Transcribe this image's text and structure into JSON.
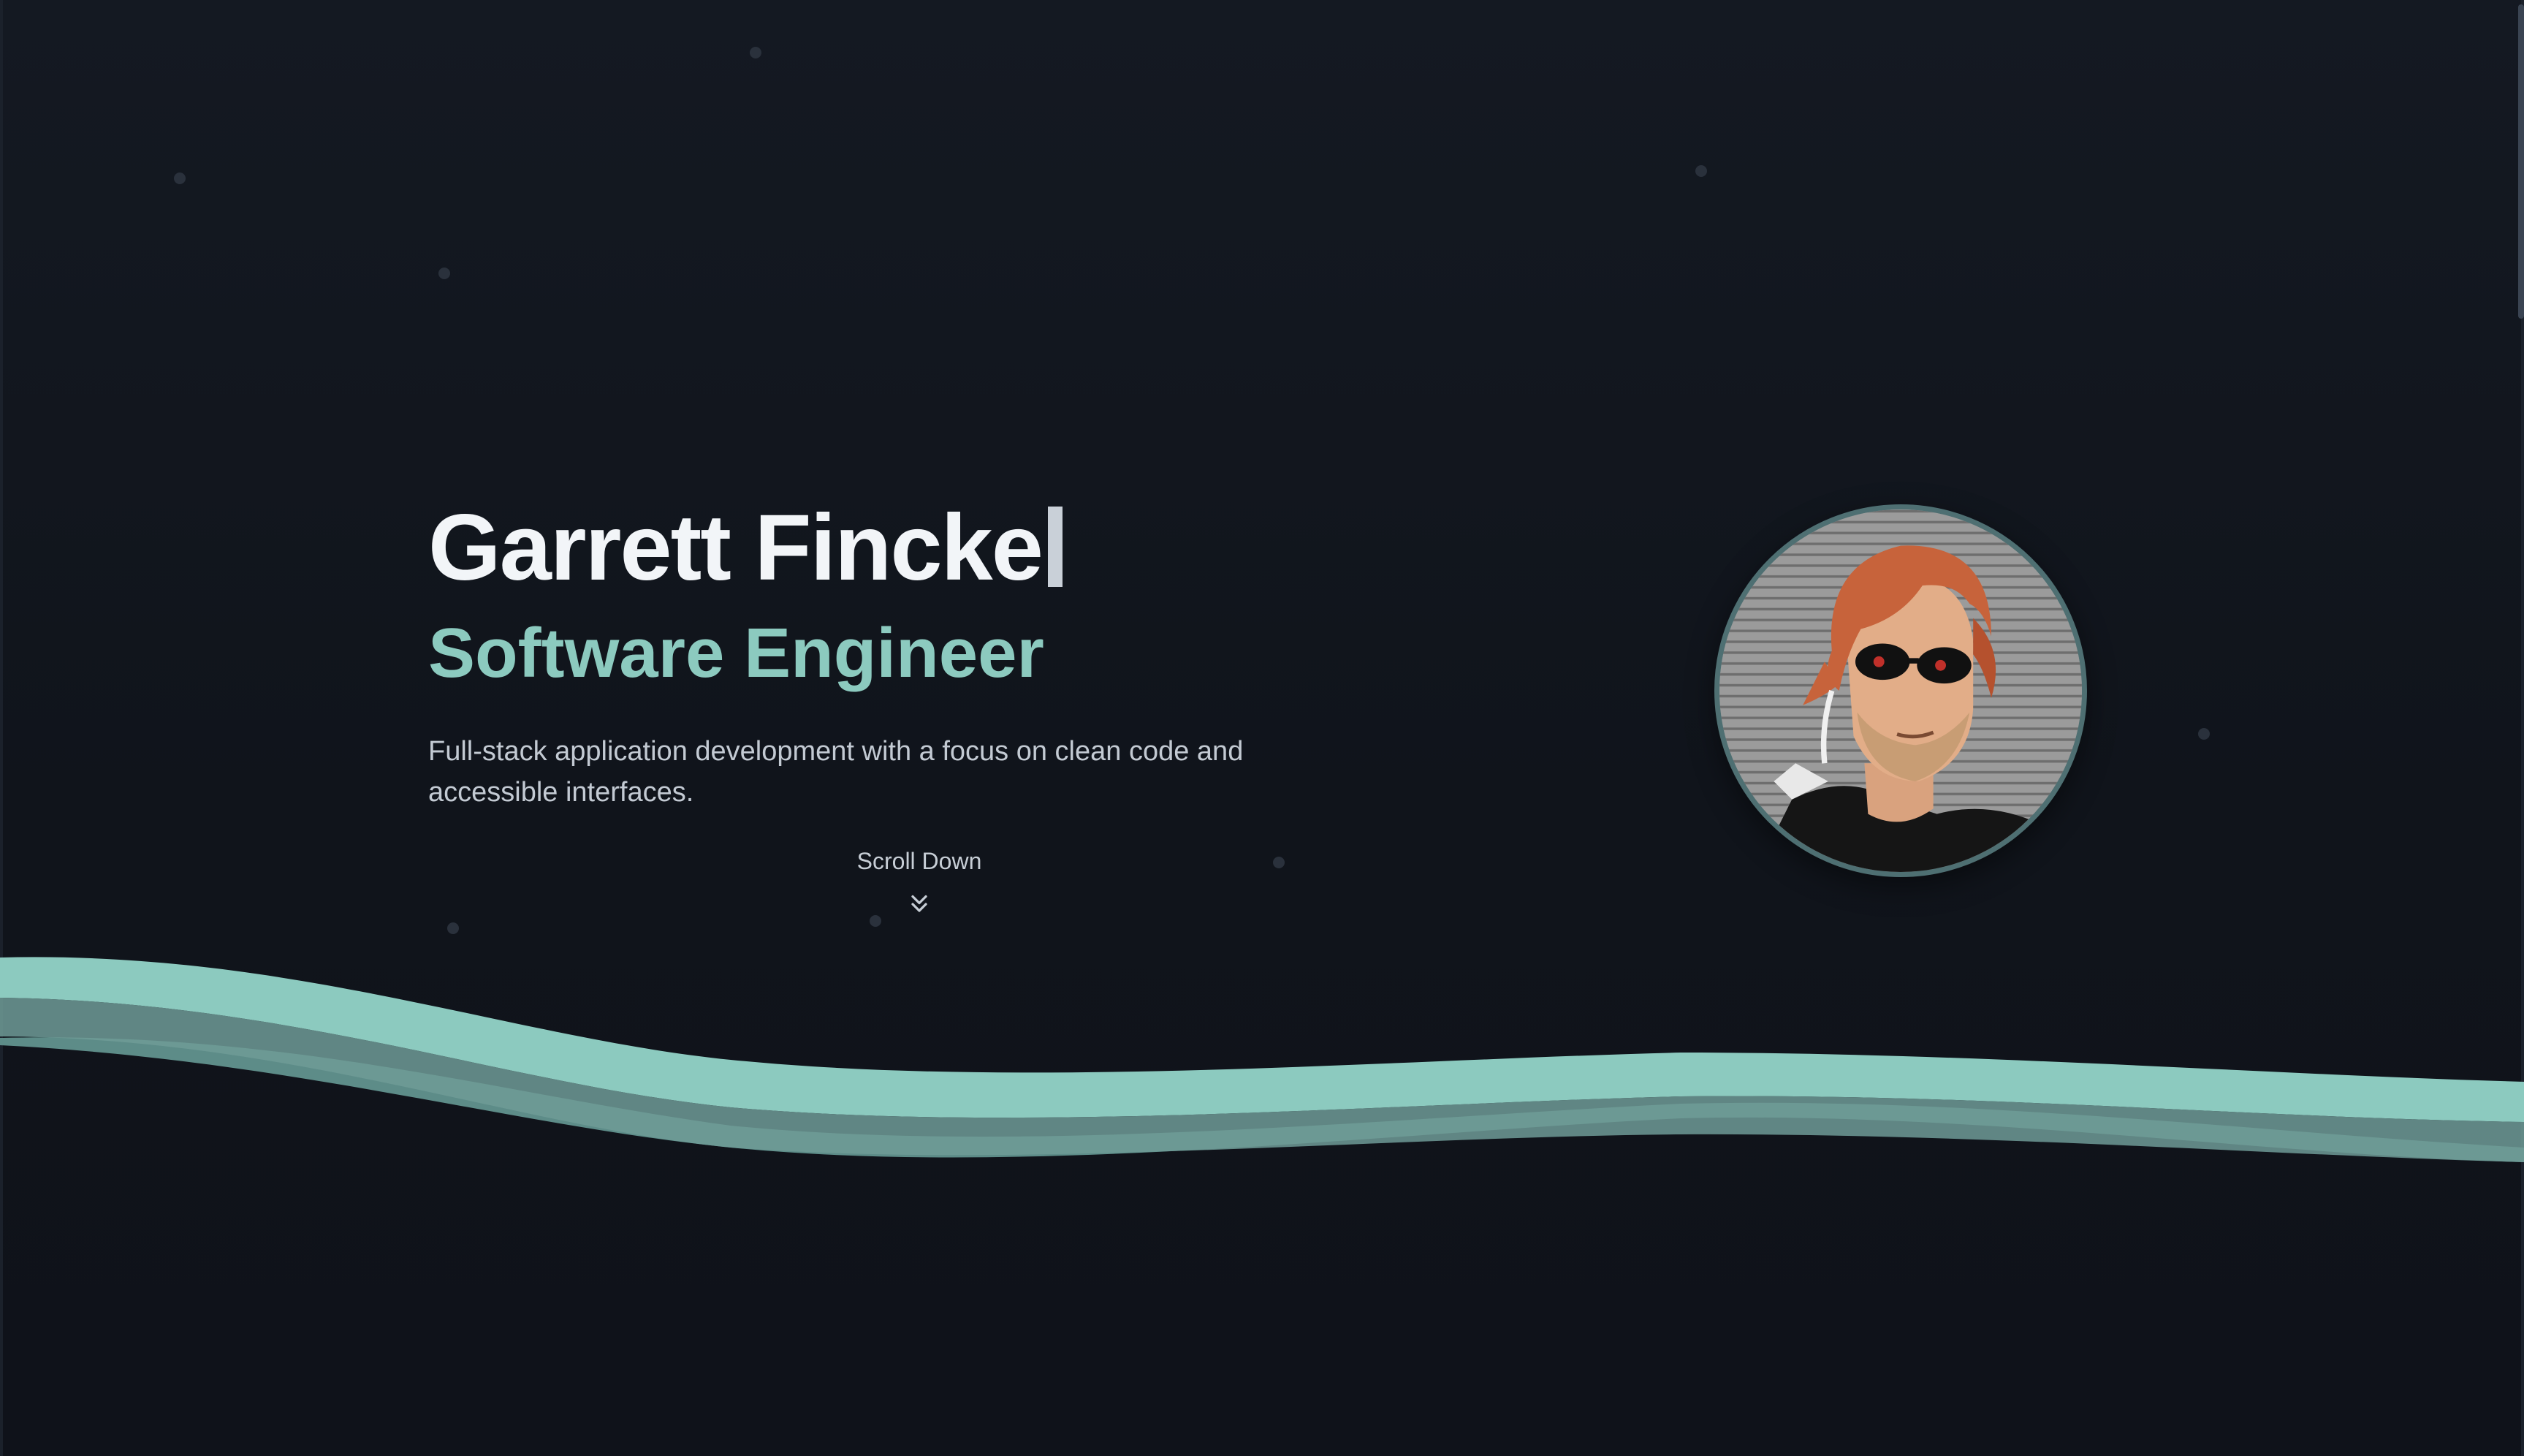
{
  "hero": {
    "name": "Garrett Fincke",
    "role": "Software Engineer",
    "tagline": "Full-stack application development with a focus on clean code and accessible interfaces."
  },
  "scroll": {
    "label": "Scroll Down",
    "icon": "double-chevron-down-icon"
  },
  "avatar": {
    "alt": "Garrett Fincke"
  },
  "colors": {
    "background": "#11151d",
    "accent": "#8ccabf",
    "wave_dark": "#5d8c88",
    "text_primary": "#f2f5f8",
    "text_secondary": "#c3cad3"
  }
}
